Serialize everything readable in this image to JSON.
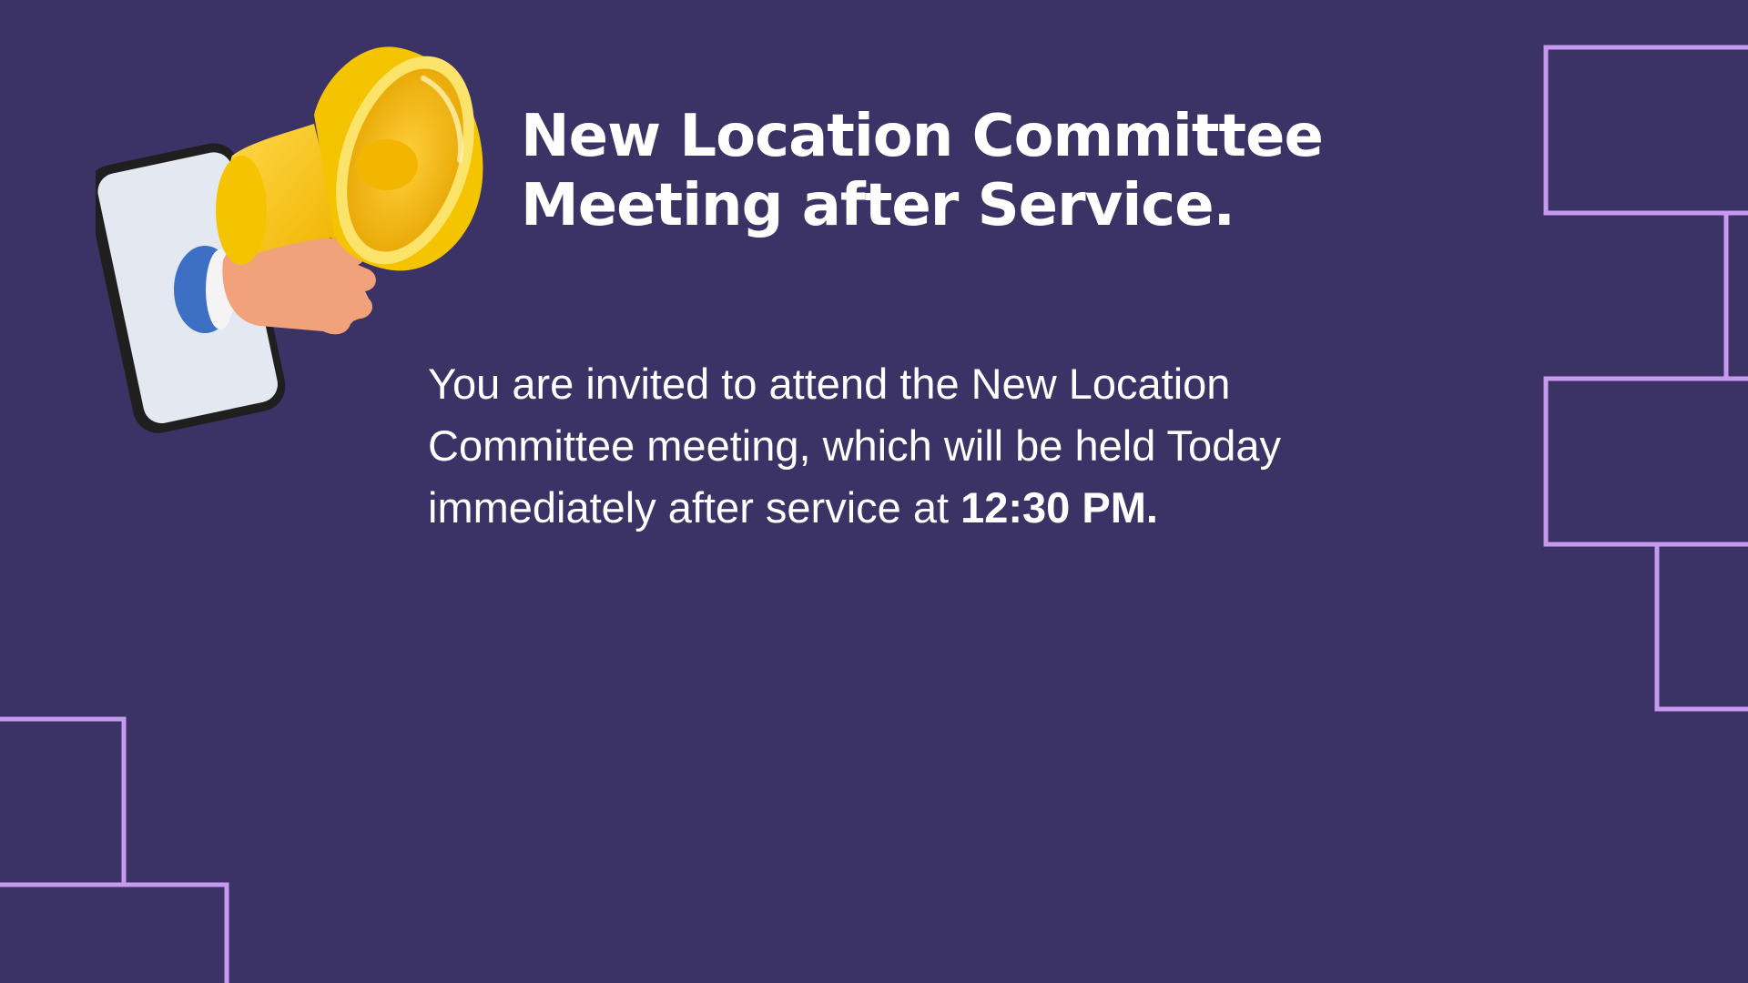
{
  "colors": {
    "background": "#3b3265",
    "outline": "#c79af0",
    "text": "#ffffff",
    "megaphone": "#f5c400",
    "phone_frame": "#232323",
    "phone_screen": "#e3e8f1",
    "sleeve": "#3d6fc4",
    "hand": "#f2a27a"
  },
  "illustration": {
    "icon": "megaphone-icon",
    "description_icon": "phone-with-hand-holding-megaphone"
  },
  "title": {
    "line1": "New Location Committee",
    "line2": "Meeting after Service."
  },
  "body": {
    "line1": "You are invited to attend the New Location",
    "line2": "Committee meeting, which will be held Today",
    "line3_prefix": "immediately after service at ",
    "time": "12:30 PM."
  }
}
